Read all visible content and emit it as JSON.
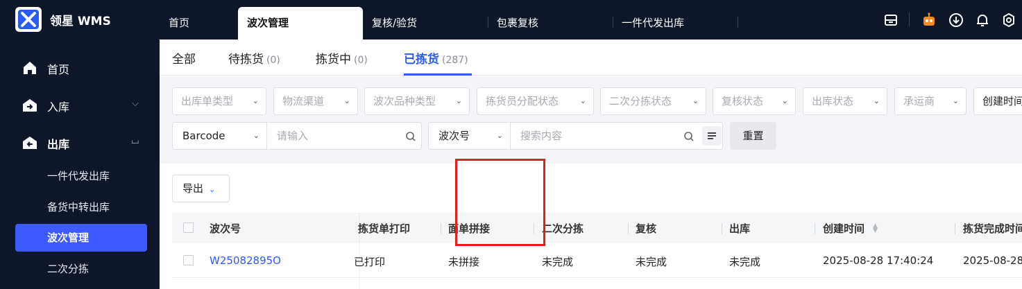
{
  "app": {
    "title": "领星 WMS"
  },
  "top_tabs": [
    {
      "label": "首页"
    },
    {
      "label": "波次管理"
    },
    {
      "label": "复核/验货"
    },
    {
      "label": "包裹复核"
    },
    {
      "label": "一件代发出库"
    }
  ],
  "top_icons": [
    "print-icon",
    "robot-icon",
    "download-icon",
    "bell-icon",
    "settings-icon"
  ],
  "sidebar": {
    "items": [
      {
        "label": "首页",
        "icon": "home-icon"
      },
      {
        "label": "入库",
        "icon": "inbound-icon"
      },
      {
        "label": "出库",
        "icon": "outbound-icon"
      }
    ],
    "sub_items": [
      {
        "label": "一件代发出库"
      },
      {
        "label": "备货中转出库"
      },
      {
        "label": "波次管理"
      },
      {
        "label": "二次分拣"
      }
    ]
  },
  "status_tabs": [
    {
      "label": "全部",
      "count": ""
    },
    {
      "label": "待拣货",
      "count": "(0)"
    },
    {
      "label": "拣货中",
      "count": "(0)"
    },
    {
      "label": "已拣货",
      "count": "(287)"
    }
  ],
  "filters": [
    "出库单类型",
    "物流渠道",
    "波次品种类型",
    "拣货员分配状态",
    "二次分拣状态",
    "复核状态",
    "出库状态",
    "承运商",
    "创建时间"
  ],
  "search": {
    "field1_select": "Barcode",
    "field1_placeholder": "请输入",
    "field2_select": "波次号",
    "field2_placeholder": "搜索内容",
    "reset": "重置"
  },
  "toolbar": {
    "export": "导出"
  },
  "table": {
    "columns": [
      "波次号",
      "拣货单打印",
      "面单拼接",
      "二次分拣",
      "复核",
      "出库",
      "创建时间",
      "拣货完成时间"
    ],
    "rows": [
      {
        "wave_no": "W25082895O",
        "pick_print": "已打印",
        "label_merge": "未拼接",
        "secondary_sort": "未完成",
        "review": "未完成",
        "outbound": "未完成",
        "created": "2025-08-28 17:40:24",
        "pick_done": "2025-08-28"
      }
    ]
  },
  "colors": {
    "sidebar_bg": "#0e1629",
    "accent": "#2a5cf5",
    "active_menu": "#3d5afe",
    "highlight": "#e0201c"
  }
}
